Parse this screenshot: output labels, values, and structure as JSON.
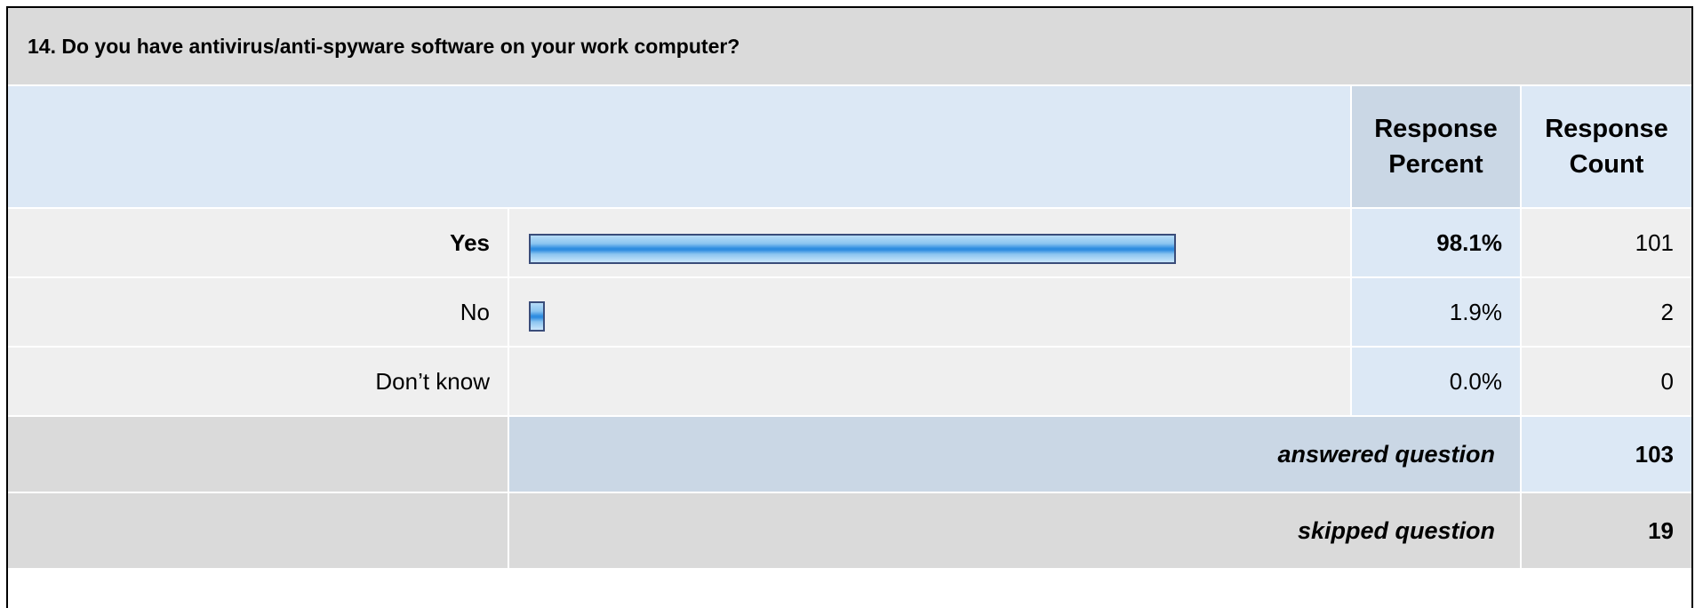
{
  "question": "14. Do you have antivirus/anti-spyware software on your work computer?",
  "headers": {
    "percent_line1": "Response",
    "percent_line2": "Percent",
    "count_line1": "Response",
    "count_line2": "Count"
  },
  "chart_data": {
    "type": "bar",
    "categories": [
      "Yes",
      "No",
      "Don’t know"
    ],
    "percent_labels": [
      "98.1%",
      "1.9%",
      "0.0%"
    ],
    "percent_values": [
      98.1,
      1.9,
      0.0
    ],
    "counts": [
      "101",
      "2",
      "0"
    ],
    "bar_color": "#4a9ce6"
  },
  "summary": {
    "answered_label": "answered question",
    "answered_count": "103",
    "skipped_label": "skipped question",
    "skipped_count": "19"
  }
}
